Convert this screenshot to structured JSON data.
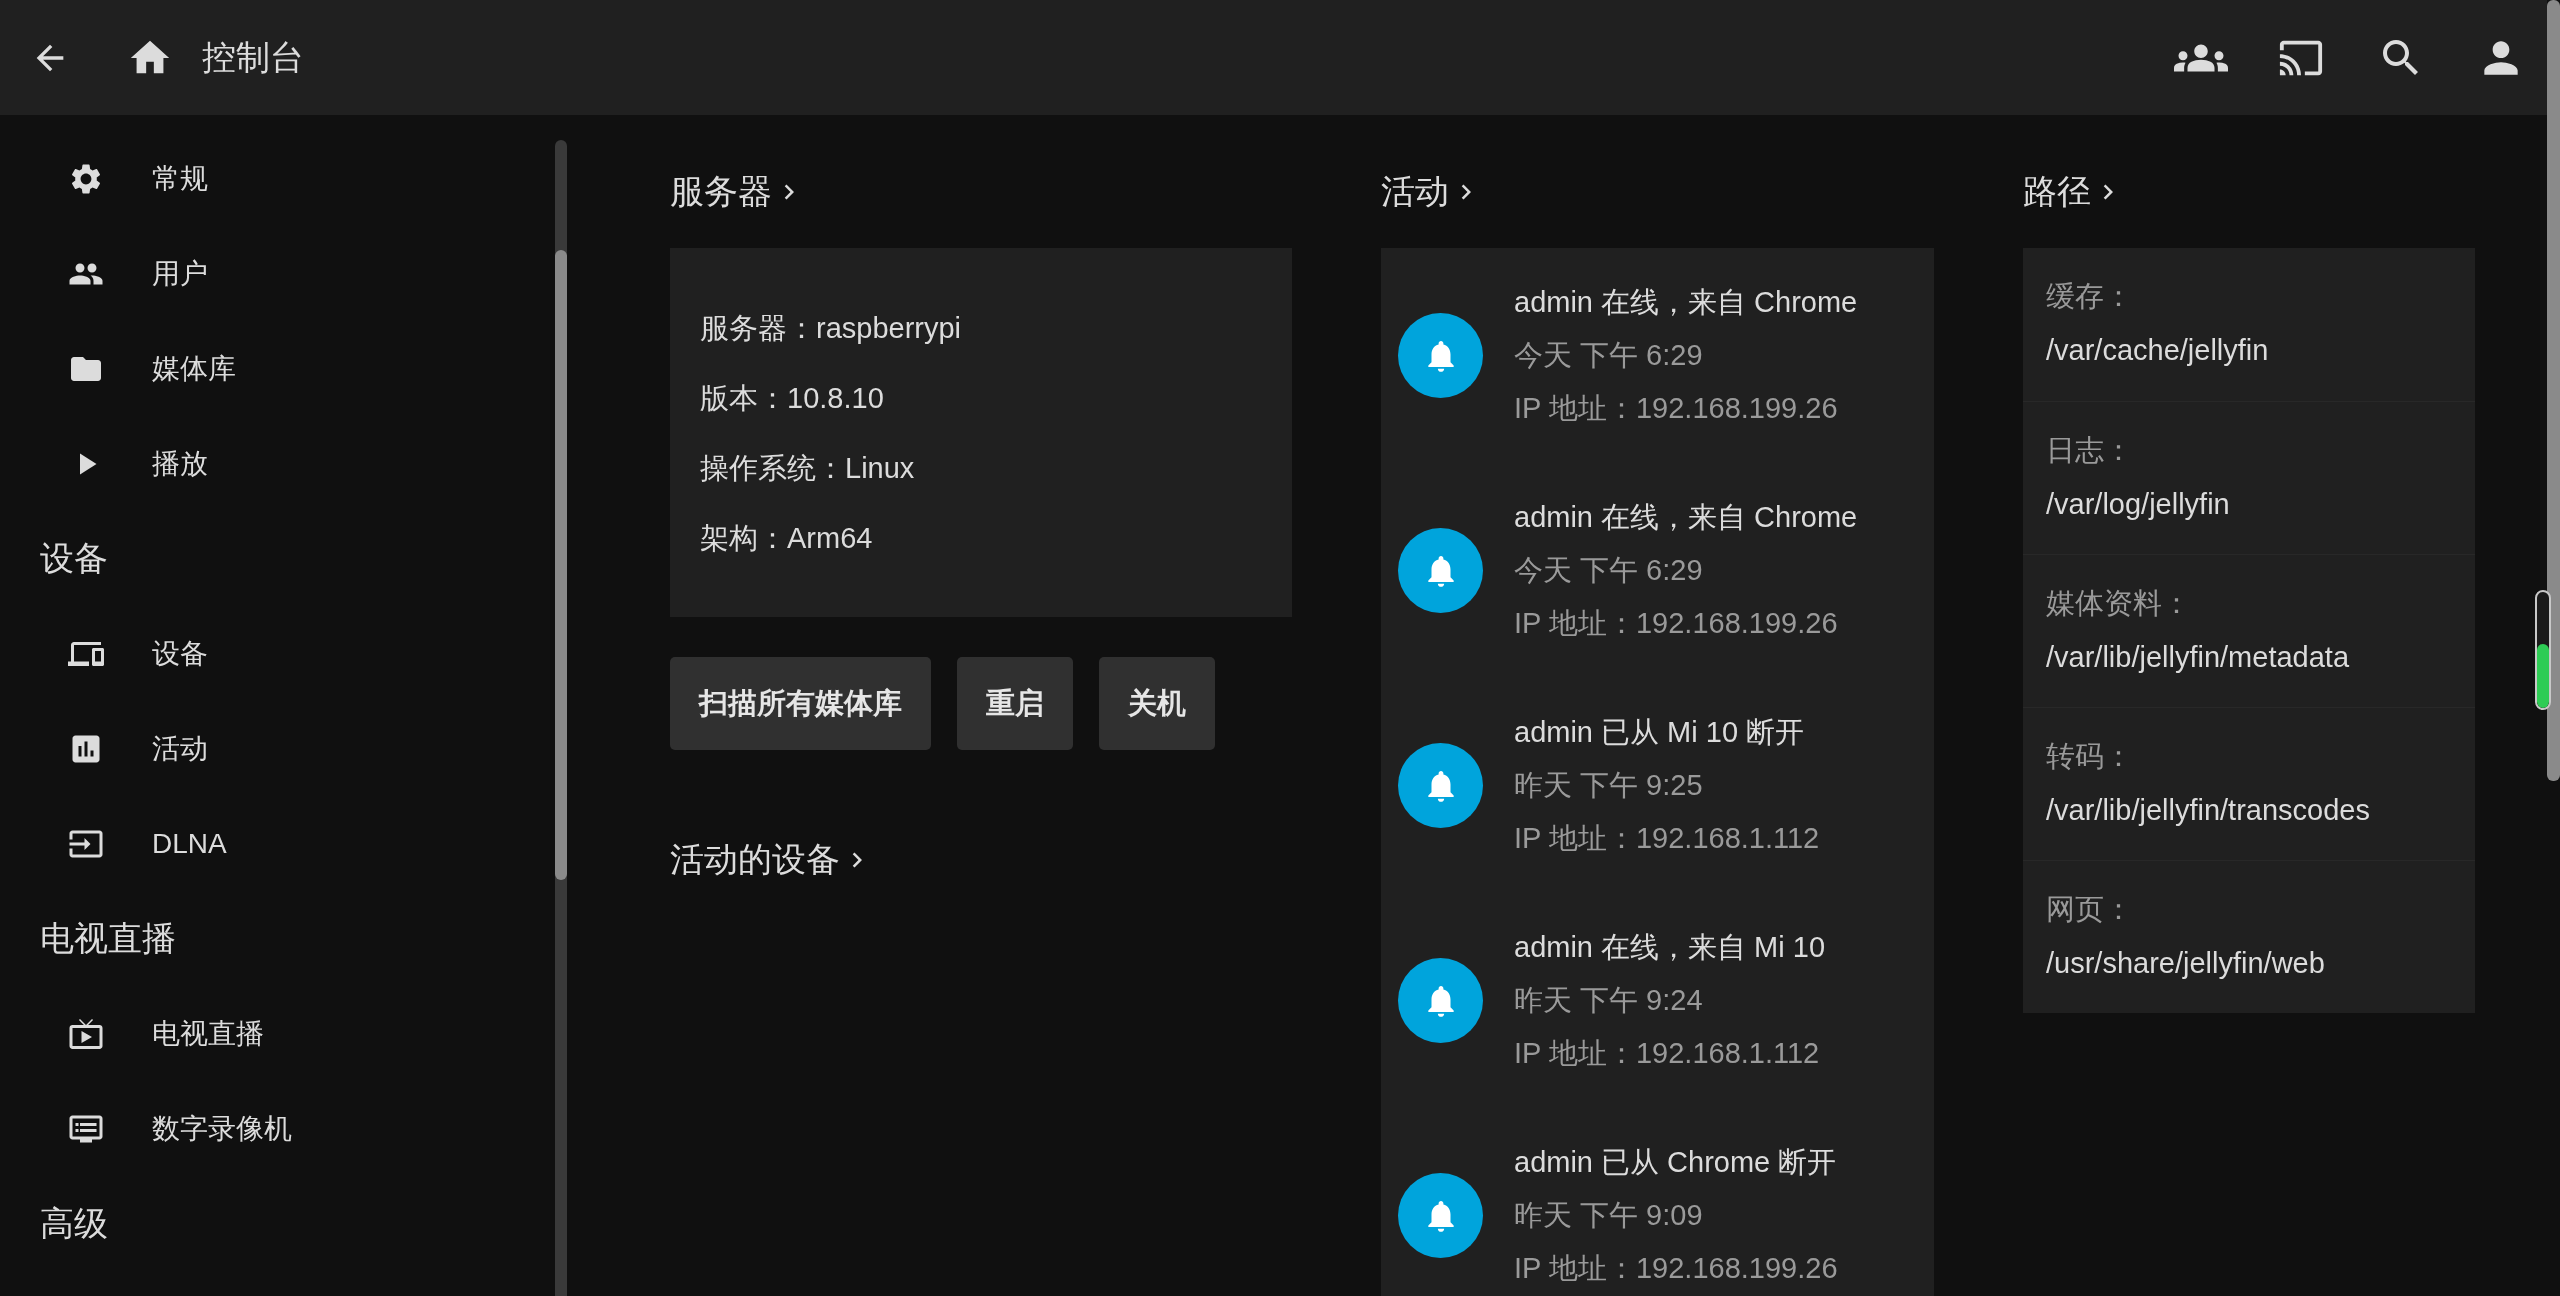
{
  "header": {
    "title": "控制台"
  },
  "sidebar": {
    "sections": [
      {
        "items": [
          {
            "label": "常规"
          },
          {
            "label": "用户"
          },
          {
            "label": "媒体库"
          },
          {
            "label": "播放"
          }
        ]
      },
      {
        "title": "设备",
        "items": [
          {
            "label": "设备"
          },
          {
            "label": "活动"
          },
          {
            "label": "DLNA"
          }
        ]
      },
      {
        "title": "电视直播",
        "items": [
          {
            "label": "电视直播"
          },
          {
            "label": "数字录像机"
          }
        ]
      },
      {
        "title": "高级"
      }
    ]
  },
  "server": {
    "title": "服务器",
    "info": [
      "服务器：raspberrypi",
      "版本：10.8.10",
      "操作系统：Linux",
      "架构：Arm64"
    ],
    "buttons": [
      "扫描所有媒体库",
      "重启",
      "关机"
    ],
    "devices_title": "活动的设备"
  },
  "activity": {
    "title": "活动",
    "items": [
      {
        "title": "admin 在线，来自 Chrome",
        "time": "今天 下午 6:29",
        "ip": "IP 地址：192.168.199.26"
      },
      {
        "title": "admin 在线，来自 Chrome",
        "time": "今天 下午 6:29",
        "ip": "IP 地址：192.168.199.26"
      },
      {
        "title": "admin 已从 Mi 10 断开",
        "time": "昨天 下午 9:25",
        "ip": "IP 地址：192.168.1.112"
      },
      {
        "title": "admin 在线，来自 Mi 10",
        "time": "昨天 下午 9:24",
        "ip": "IP 地址：192.168.1.112"
      },
      {
        "title": "admin 已从 Chrome 断开",
        "time": "昨天 下午 9:09",
        "ip": "IP 地址：192.168.199.26"
      }
    ]
  },
  "paths": {
    "title": "路径",
    "items": [
      {
        "label": "缓存：",
        "value": "/var/cache/jellyfin"
      },
      {
        "label": "日志：",
        "value": "/var/log/jellyfin"
      },
      {
        "label": "媒体资料：",
        "value": "/var/lib/jellyfin/metadata"
      },
      {
        "label": "转码：",
        "value": "/var/lib/jellyfin/transcodes"
      },
      {
        "label": "网页：",
        "value": "/usr/share/jellyfin/web"
      }
    ]
  }
}
